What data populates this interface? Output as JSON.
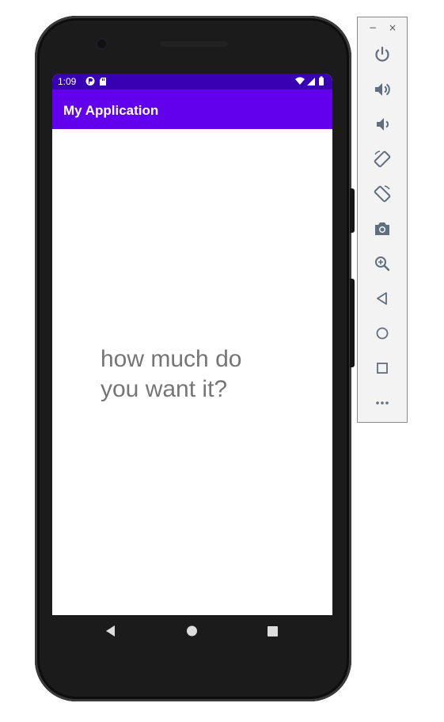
{
  "status_bar": {
    "time": "1:09"
  },
  "app_bar": {
    "title": "My Application"
  },
  "content": {
    "text": "how much do you want it?"
  },
  "emulator_toolbar": {
    "minimize": "−",
    "close": "×",
    "more": "•••",
    "buttons": [
      "power-icon",
      "volume-up-icon",
      "volume-down-icon",
      "rotate-left-icon",
      "rotate-right-icon",
      "camera-icon",
      "zoom-icon",
      "back-icon",
      "home-icon",
      "overview-icon",
      "more-icon"
    ]
  },
  "colors": {
    "status_bar": "#3700b3",
    "app_bar": "#6200ee",
    "text": "#757575",
    "toolbar_icon": "#5f6f7f"
  }
}
